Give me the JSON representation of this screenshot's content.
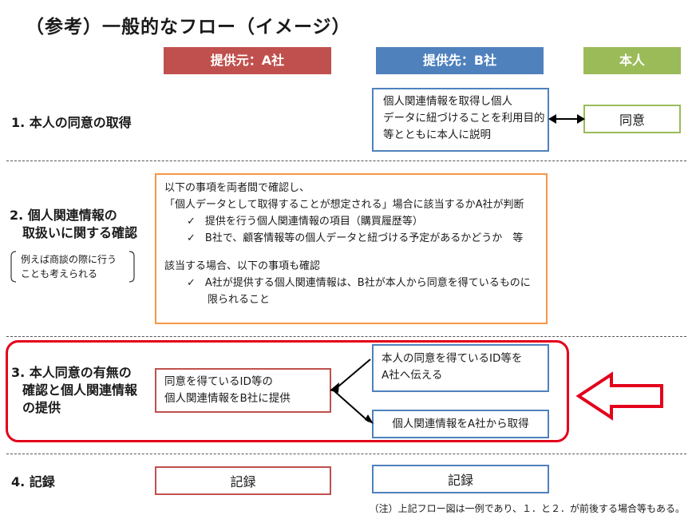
{
  "title": "（参考）一般的なフロー（イメージ）",
  "headers": {
    "provider": "提供元：A社",
    "recipient": "提供先：B社",
    "person": "本人"
  },
  "colors": {
    "provider": "#c0504d",
    "recipient": "#4f81bd",
    "person": "#9bbb59",
    "orange": "#f79646",
    "red": "#e3001b"
  },
  "step1": {
    "label": "1. 本人の同意の取得",
    "recipient_box": [
      "個人関連情報を取得し個人",
      "データに紐づけることを利用目的",
      "等とともに本人に説明"
    ],
    "person_box": "同意"
  },
  "step2": {
    "label": [
      "2. 個人関連情報の",
      "取扱いに関する確認"
    ],
    "note": [
      "例えば商談の際に行う",
      "ことも考えられる"
    ],
    "box": {
      "line1": "以下の事項を両者間で確認し、",
      "line2": "「個人データとして取得することが想定される」場合に該当するかA社が判断",
      "check1": "提供を行う個人関連情報の項目（購買履歴等）",
      "check2": "B社で、顧客情報等の個人データと紐づける予定があるかどうか　等",
      "line3": "該当する場合、以下の事項も確認",
      "check3": [
        "A社が提供する個人関連情報は、B社が本人から同意を得ているものに",
        "限られること"
      ]
    }
  },
  "step3": {
    "label": [
      "3. 本人同意の有無の",
      "確認と個人関連情報",
      "の提供"
    ],
    "provider_box": [
      "同意を得ているID等の",
      "個人関連情報をB社に提供"
    ],
    "recipient_box1": [
      "本人の同意を得ているID等を",
      "A社へ伝える"
    ],
    "recipient_box2": "個人関連情報をA社から取得"
  },
  "step4": {
    "label": "4. 記録",
    "provider_box": "記録",
    "recipient_box": "記録"
  },
  "footnote": "（注）上記フロー図は一例であり、１．と２．が前後する場合等もある。"
}
